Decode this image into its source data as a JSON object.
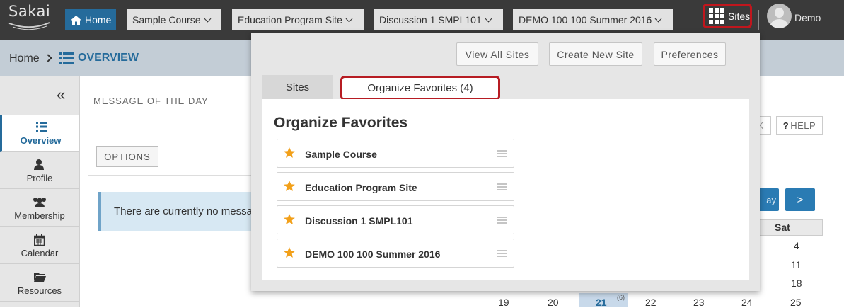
{
  "topbar": {
    "logo_text": "Sakai",
    "home_label": "Home",
    "sites": [
      {
        "label": "Sample Course"
      },
      {
        "label": "Education Program Site"
      },
      {
        "label": "Discussion 1 SMPL101"
      },
      {
        "label": "DEMO 100 100 Summer 2016"
      }
    ],
    "sites_button_label": "Sites",
    "user_name": "Demo"
  },
  "breadcrumb": {
    "home": "Home",
    "title": "OVERVIEW"
  },
  "sidebar": {
    "collapse_glyph": "«",
    "items": [
      {
        "label": "Overview",
        "icon": "list-icon"
      },
      {
        "label": "Profile",
        "icon": "user-icon"
      },
      {
        "label": "Membership",
        "icon": "users-icon"
      },
      {
        "label": "Calendar",
        "icon": "calendar-icon"
      },
      {
        "label": "Resources",
        "icon": "folder-icon"
      }
    ]
  },
  "main": {
    "motd_title": "MESSAGE OF THE DAY",
    "options_label": "OPTIONS",
    "notice_text": "There are currently no messages",
    "help_label": "HELP",
    "help_icon": "?",
    "k_label": "K",
    "calendar": {
      "prev_label": "ay",
      "next_label": ">",
      "sat_header": "Sat",
      "sat_numbers": [
        "4",
        "11",
        "18"
      ],
      "last_row": [
        "19",
        "20",
        "21",
        "22",
        "23",
        "24",
        "25"
      ],
      "today_count": "(6)"
    }
  },
  "dropdown": {
    "buttons": {
      "view_all": "View All Sites",
      "create_new": "Create New Site",
      "preferences": "Preferences"
    },
    "tabs": {
      "sites": "Sites",
      "organize": "Organize Favorites (4)"
    },
    "heading": "Organize Favorites",
    "favorites": [
      {
        "name": "Sample Course"
      },
      {
        "name": "Education Program Site"
      },
      {
        "name": "Discussion 1 SMPL101"
      },
      {
        "name": "DEMO 100 100 Summer 2016"
      }
    ]
  },
  "colors": {
    "topbar": "#3a3a3a",
    "accent": "#256b9b",
    "highlight": "#c0161d",
    "star": "#f2a01a"
  }
}
